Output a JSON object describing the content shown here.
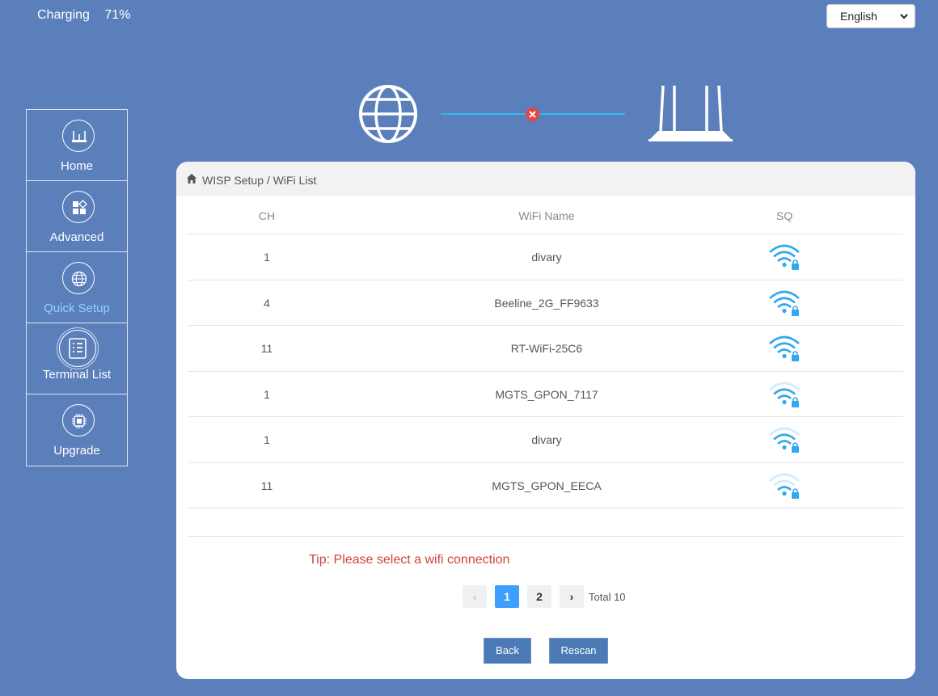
{
  "status": {
    "charging": "Charging",
    "battery": "71%"
  },
  "language": {
    "selected": "English"
  },
  "sidebar": {
    "items": [
      {
        "label": "Home",
        "icon": "router-icon"
      },
      {
        "label": "Advanced",
        "icon": "grid-icon"
      },
      {
        "label": "Quick Setup",
        "icon": "globe-icon",
        "active": true
      },
      {
        "label": "Terminal List",
        "icon": "list-icon"
      },
      {
        "label": "Upgrade",
        "icon": "chip-icon"
      }
    ]
  },
  "topology": {
    "internet_icon": "globe-icon",
    "link_status": "disconnected",
    "router_icon": "router-icon"
  },
  "panel": {
    "breadcrumb": "WISP Setup / WiFi List",
    "table": {
      "headers": {
        "ch": "CH",
        "name": "WiFi Name",
        "sq": "SQ"
      },
      "rows": [
        {
          "ch": "1",
          "name": "divary",
          "signal": 4,
          "locked": true
        },
        {
          "ch": "4",
          "name": "Beeline_2G_FF9633",
          "signal": 4,
          "locked": true
        },
        {
          "ch": "11",
          "name": "RT-WiFi-25C6",
          "signal": 4,
          "locked": true
        },
        {
          "ch": "1",
          "name": "MGTS_GPON_7117",
          "signal": 3,
          "locked": true
        },
        {
          "ch": "1",
          "name": "divary",
          "signal": 3,
          "locked": true
        },
        {
          "ch": "11",
          "name": "MGTS_GPON_EECA",
          "signal": 2,
          "locked": true
        }
      ]
    },
    "tip": "Tip: Please select a wifi connection",
    "pagination": {
      "prev": "‹",
      "pages": [
        "1",
        "2"
      ],
      "current": "1",
      "next": "›",
      "total": "Total 10"
    },
    "buttons": {
      "back": "Back",
      "rescan": "Rescan"
    }
  },
  "colors": {
    "background": "#5b7fbb",
    "accent": "#3c9ffe",
    "wifi": "#32a8ef",
    "tip": "#d0443e",
    "error": "#e64545"
  }
}
